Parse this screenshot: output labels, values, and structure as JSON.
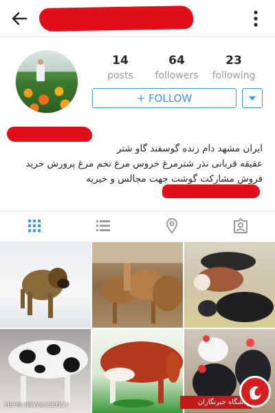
{
  "header": {
    "back_icon": "arrow-left-icon",
    "menu_icon": "vertical-dots-icon"
  },
  "profile": {
    "stats": [
      {
        "value": "14",
        "label": "posts"
      },
      {
        "value": "64",
        "label": "followers"
      },
      {
        "value": "23",
        "label": "following"
      }
    ],
    "follow_label": "+ FOLLOW",
    "bio_lines": [
      "ایران مشهد دام زنده گوسفند گاو شتر",
      "عقیقه قربانی نذر شترمرغ خروس مرغ تخم مرغ  پرورش خرید",
      "فروش  مشارکت  گوشت جهت مجالس و خیریه"
    ]
  },
  "tabs": [
    {
      "icon": "grid-icon",
      "active": true
    },
    {
      "icon": "list-icon",
      "active": false
    },
    {
      "icon": "location-pin-icon",
      "active": false
    },
    {
      "icon": "tagged-person-icon",
      "active": false
    }
  ],
  "watermarks": {
    "news_agency": "MEHR NEWSAGENCY",
    "badge_text": "باشگاه خبرنگاران"
  },
  "colors": {
    "accent": "#3897f0",
    "redaction": "#e20f1a"
  }
}
